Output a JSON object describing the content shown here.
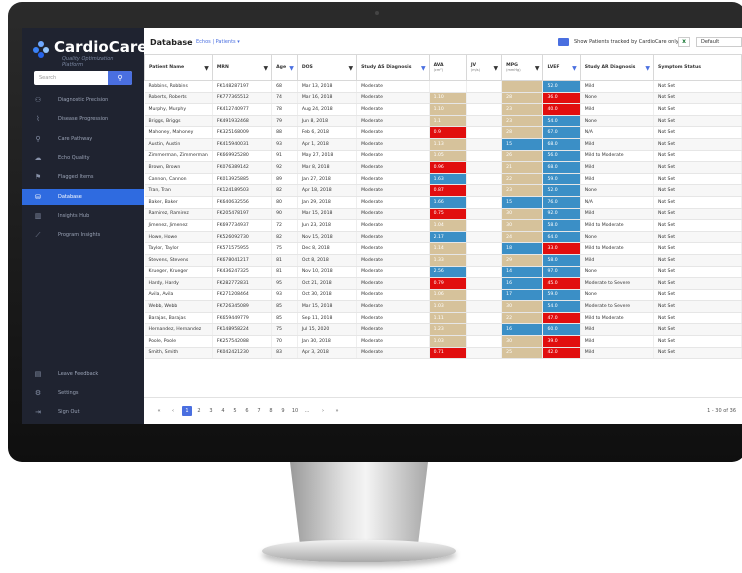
{
  "app": {
    "name": "CardioCare",
    "tagline": "Quality Optimization Platform"
  },
  "sidebar": {
    "search_placeholder": "Search",
    "items": [
      {
        "label": "Diagnostic Precision",
        "icon": "people-icon"
      },
      {
        "label": "Disease Progression",
        "icon": "chart-line-icon"
      },
      {
        "label": "Care Pathway",
        "icon": "pathway-icon"
      },
      {
        "label": "Echo Quality",
        "icon": "cloud-icon"
      },
      {
        "label": "Flagged Items",
        "icon": "flag-icon"
      },
      {
        "label": "Database",
        "icon": "database-icon",
        "active": true
      },
      {
        "label": "Insights Hub",
        "icon": "bar-chart-icon"
      },
      {
        "label": "Program Insights",
        "icon": "trend-icon"
      }
    ],
    "bottom_items": [
      {
        "label": "Leave Feedback",
        "icon": "comment-icon"
      },
      {
        "label": "Settings",
        "icon": "gear-icon"
      },
      {
        "label": "Sign Out",
        "icon": "sign-out-icon"
      }
    ]
  },
  "header": {
    "title": "Database",
    "crumb_echo": "Echos",
    "crumb_sep": "|",
    "crumb_patients": "Patients ▾",
    "toggle_label": "Show Patients tracked by CardioCare only",
    "default_label": "Default"
  },
  "table": {
    "columns": [
      "Patient Name",
      "MRN",
      "Age",
      "DOS",
      "Study AS Diagnosis",
      "AVA",
      "JV",
      "MPG",
      "LVEF",
      "Study AR Diagnosis",
      "Symptom Status"
    ],
    "column_subs": {
      "AVA": "(cm²)",
      "JV": "(m/s)",
      "MPG": "(mmHg)"
    },
    "rows": [
      [
        "Robbins, Robbins",
        "FK148287197",
        "68",
        "Mar 13, 2018",
        "Moderate",
        "",
        "",
        "",
        "52.0",
        "Mild",
        "Not Set"
      ],
      [
        "Roberts, Roberts",
        "FK777365512",
        "74",
        "Mar 16, 2018",
        "Moderate",
        "1.10",
        "",
        "28",
        "36.0",
        "None",
        "Not Set"
      ],
      [
        "Murphy, Murphy",
        "FK412740977",
        "78",
        "Aug 24, 2018",
        "Moderate",
        "1.10",
        "",
        "23",
        "40.0",
        "Mild",
        "Not Set"
      ],
      [
        "Briggs, Briggs",
        "FK491932468",
        "79",
        "Jun 8, 2018",
        "Moderate",
        "1.1",
        "",
        "23",
        "54.0",
        "None",
        "Not Set"
      ],
      [
        "Mahoney, Mahoney",
        "FK325168009",
        "88",
        "Feb 6, 2018",
        "Moderate",
        "0.9",
        "",
        "28",
        "67.0",
        "N/A",
        "Not Set"
      ],
      [
        "Austin, Austin",
        "FK415940031",
        "93",
        "Apr 1, 2018",
        "Moderate",
        "1.13",
        "",
        "15",
        "68.0",
        "Mild",
        "Not Set"
      ],
      [
        "Zimmerman, Zimmerman",
        "FK669925280",
        "91",
        "May 27, 2018",
        "Moderate",
        "1.05",
        "",
        "26",
        "56.0",
        "Mild to Moderate",
        "Not Set"
      ],
      [
        "Brown, Brown",
        "FK076389142",
        "92",
        "Mar 8, 2018",
        "Moderate",
        "0.96",
        "",
        "21",
        "68.0",
        "Mild",
        "Not Set"
      ],
      [
        "Cannon, Cannon",
        "FK013925885",
        "89",
        "Jan 27, 2018",
        "Moderate",
        "1.63",
        "",
        "22",
        "59.0",
        "Mild",
        "Not Set"
      ],
      [
        "Tran, Tran",
        "FK124189503",
        "82",
        "Apr 18, 2018",
        "Moderate",
        "0.87",
        "",
        "23",
        "52.0",
        "None",
        "Not Set"
      ],
      [
        "Baker, Baker",
        "FK640632556",
        "80",
        "Jan 29, 2018",
        "Moderate",
        "1.66",
        "",
        "15",
        "76.0",
        "N/A",
        "Not Set"
      ],
      [
        "Ramirez, Ramirez",
        "FK205478197",
        "90",
        "Mar 15, 2018",
        "Moderate",
        "0.75",
        "",
        "30",
        "92.0",
        "Mild",
        "Not Set"
      ],
      [
        "Jimenez, Jimenez",
        "FK697734937",
        "72",
        "Jun 23, 2018",
        "Moderate",
        "1.04",
        "",
        "30",
        "58.0",
        "Mild to Moderate",
        "Not Set"
      ],
      [
        "Howe, Howe",
        "FK526092730",
        "82",
        "Nov 15, 2018",
        "Moderate",
        "2.17",
        "",
        "24",
        "64.0",
        "None",
        "Not Set"
      ],
      [
        "Taylor, Taylor",
        "FK571575955",
        "75",
        "Dec 8, 2018",
        "Moderate",
        "1.14",
        "",
        "18",
        "33.0",
        "Mild to Moderate",
        "Not Set"
      ],
      [
        "Stevens, Stevens",
        "FK678041217",
        "81",
        "Oct 8, 2018",
        "Moderate",
        "1.33",
        "",
        "29",
        "58.0",
        "Mild",
        "Not Set"
      ],
      [
        "Krueger, Krueger",
        "FK436247325",
        "81",
        "Nov 10, 2018",
        "Moderate",
        "2.56",
        "",
        "14",
        "97.0",
        "None",
        "Not Set"
      ],
      [
        "Hardy, Hardy",
        "FK282772831",
        "95",
        "Oct 21, 2018",
        "Moderate",
        "0.79",
        "",
        "16",
        "45.0",
        "Moderate to Severe",
        "Not Set"
      ],
      [
        "Avila, Avila",
        "FK271208464",
        "93",
        "Oct 30, 2018",
        "Moderate",
        "1.06",
        "",
        "17",
        "59.0",
        "None",
        "Not Set"
      ],
      [
        "Webb, Webb",
        "FK726345089",
        "85",
        "Mar 15, 2018",
        "Moderate",
        "1.03",
        "",
        "30",
        "54.0",
        "Moderate to Severe",
        "Not Set"
      ],
      [
        "Barajas, Barajas",
        "FK659449779",
        "85",
        "Sep 11, 2018",
        "Moderate",
        "1.11",
        "",
        "22",
        "47.0",
        "Mild to Moderate",
        "Not Set"
      ],
      [
        "Hernandez, Hernandez",
        "FK148958224",
        "75",
        "Jul 15, 2020",
        "Moderate",
        "1.23",
        "",
        "16",
        "60.0",
        "Mild",
        "Not Set"
      ],
      [
        "Poole, Poole",
        "FK257542088",
        "70",
        "Jan 30, 2018",
        "Moderate",
        "1.03",
        "",
        "30",
        "39.0",
        "Mild",
        "Not Set"
      ],
      [
        "Smith, Smith",
        "FK042421230",
        "83",
        "Apr 3, 2018",
        "Moderate",
        "0.71",
        "",
        "25",
        "42.0",
        "Mild",
        "Not Set"
      ]
    ],
    "ava_colors": [
      "",
      "tan",
      "tan",
      "tan",
      "red",
      "tan",
      "tan",
      "red",
      "blue",
      "red",
      "blue",
      "red",
      "tan",
      "blue",
      "tan",
      "tan",
      "blue",
      "red",
      "tan",
      "tan",
      "tan",
      "tan",
      "tan",
      "red"
    ],
    "mpg_colors": [
      "tan",
      "tan",
      "tan",
      "tan",
      "tan",
      "blue",
      "tan",
      "tan",
      "tan",
      "tan",
      "blue",
      "tan",
      "tan",
      "tan",
      "blue",
      "tan",
      "blue",
      "blue",
      "blue",
      "tan",
      "tan",
      "blue",
      "tan",
      "tan"
    ],
    "lvef_colors": [
      "blue",
      "red",
      "red",
      "blue",
      "blue",
      "blue",
      "blue",
      "blue",
      "blue",
      "blue",
      "blue",
      "blue",
      "blue",
      "blue",
      "red",
      "blue",
      "blue",
      "red",
      "blue",
      "blue",
      "red",
      "blue",
      "red",
      "red"
    ]
  },
  "pager": {
    "pages": [
      "1",
      "2",
      "3",
      "4",
      "5",
      "6",
      "7",
      "8",
      "9",
      "10",
      "..."
    ],
    "first": "«",
    "prev": "‹",
    "next": "›",
    "last": "»",
    "range": "1 - 30 of 36"
  },
  "colors": {
    "sidebar_bg": "#1f2330",
    "accent": "#2f6be0",
    "tan": "#d6c29b",
    "red": "#e10e0e",
    "blue": "#3b8fc6"
  }
}
